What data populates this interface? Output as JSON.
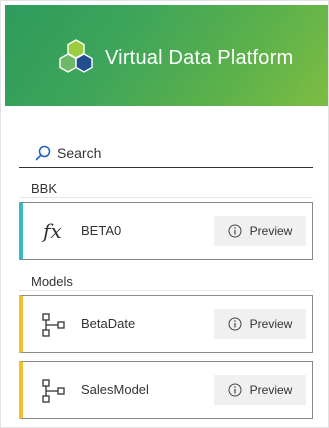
{
  "header": {
    "title": "Virtual Data Platform",
    "logo_icon": "hexagon-cluster-logo",
    "gradient_start": "#2f9a5c",
    "gradient_end": "#7dbd43"
  },
  "search": {
    "placeholder": "Search",
    "value": "",
    "icon": "search-icon"
  },
  "sections": [
    {
      "label": "BBK",
      "accent_color": "#3ab8c4",
      "items": [
        {
          "name": "BETA0",
          "icon": "function-fx-icon",
          "action_label": "Preview"
        }
      ]
    },
    {
      "label": "Models",
      "accent_color": "#f2c12e",
      "items": [
        {
          "name": "BetaDate",
          "icon": "model-hierarchy-icon",
          "action_label": "Preview"
        },
        {
          "name": "SalesModel",
          "icon": "model-hierarchy-icon",
          "action_label": "Preview"
        }
      ]
    }
  ]
}
